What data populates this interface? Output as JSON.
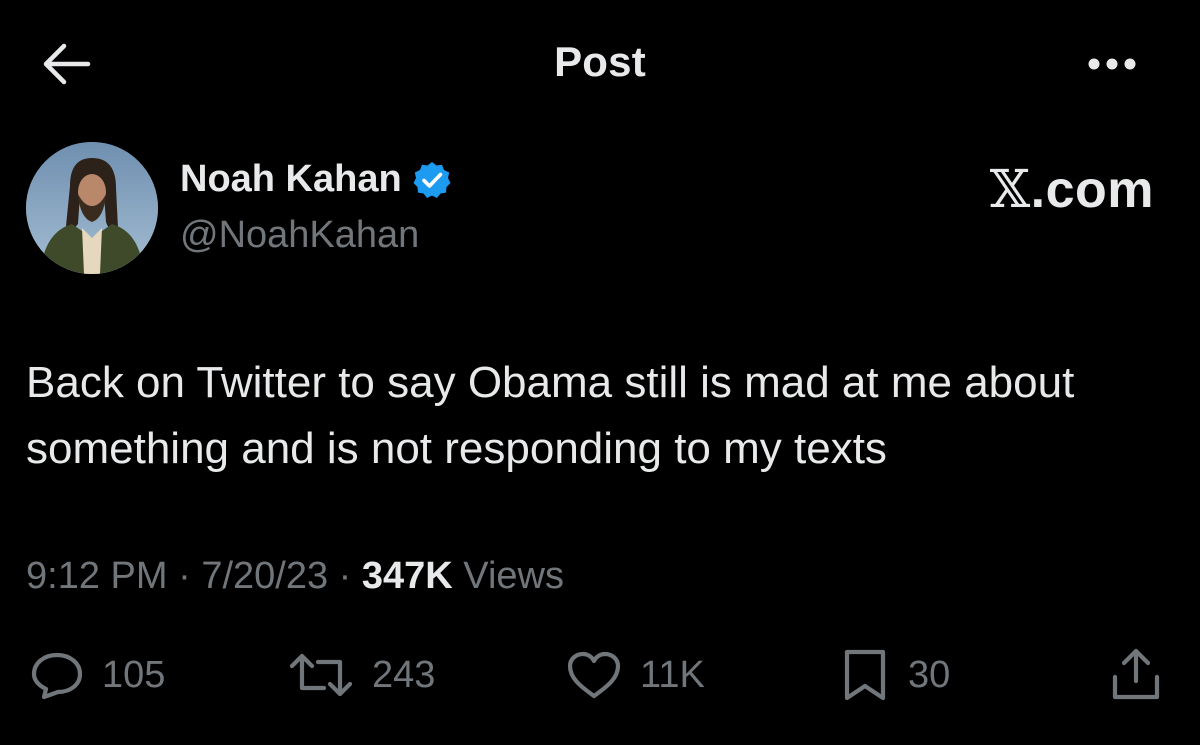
{
  "header": {
    "title": "Post"
  },
  "icons": {
    "back": "arrow-left-icon",
    "more": "more-horizontal-icon",
    "verified": "verified-badge-icon",
    "reply": "reply-icon",
    "repost": "repost-icon",
    "like": "heart-icon",
    "bookmark": "bookmark-icon",
    "share": "share-icon"
  },
  "author": {
    "name": "Noah Kahan",
    "handle": "@NoahKahan"
  },
  "brand": {
    "x": "𝕏",
    "domain": ".com"
  },
  "post": {
    "text": "Back on Twitter to say Obama still is mad at me about something and is not responding to my texts"
  },
  "meta": {
    "time": "9:12 PM",
    "sep1": " · ",
    "date": "7/20/23",
    "sep2": " · ",
    "views_count": "347K",
    "views_label": " Views"
  },
  "actions": {
    "replies": "105",
    "reposts": "243",
    "likes": "11K",
    "bookmarks": "30"
  },
  "colors": {
    "background": "#000000",
    "text": "#e7e9ea",
    "secondary": "#71767b",
    "verified": "#1d9bf0"
  }
}
